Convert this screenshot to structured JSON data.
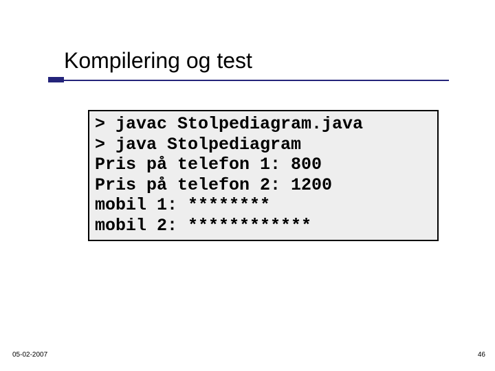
{
  "slide": {
    "title": "Kompilering og test",
    "code_lines": [
      "> javac Stolpediagram.java",
      "> java Stolpediagram",
      "Pris på telefon 1: 800",
      "Pris på telefon 2: 1200",
      "mobil 1: ********",
      "mobil 2: ************"
    ],
    "footer_date": "05-02-2007",
    "page_number": "46"
  }
}
